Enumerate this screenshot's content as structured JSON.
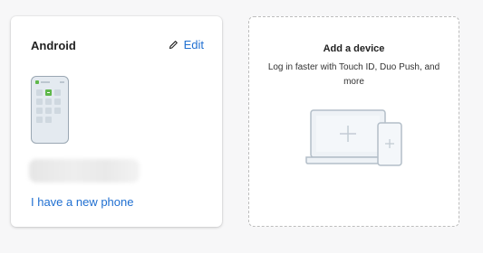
{
  "device_card": {
    "title": "Android",
    "edit_label": "Edit",
    "edit_icon": "pencil-icon",
    "device_icon": "phone-icon",
    "new_phone_link": "I have a new phone"
  },
  "add_device_card": {
    "title": "Add a device",
    "description": "Log in faster with Touch ID, Duo Push, and more",
    "illustration": "laptop-and-phone-icon"
  },
  "colors": {
    "link": "#1f6fd1",
    "page_background": "#f7f7f8",
    "card_background": "#ffffff",
    "dashed_border": "#bdbdbd",
    "duo_green": "#5fb84b"
  }
}
